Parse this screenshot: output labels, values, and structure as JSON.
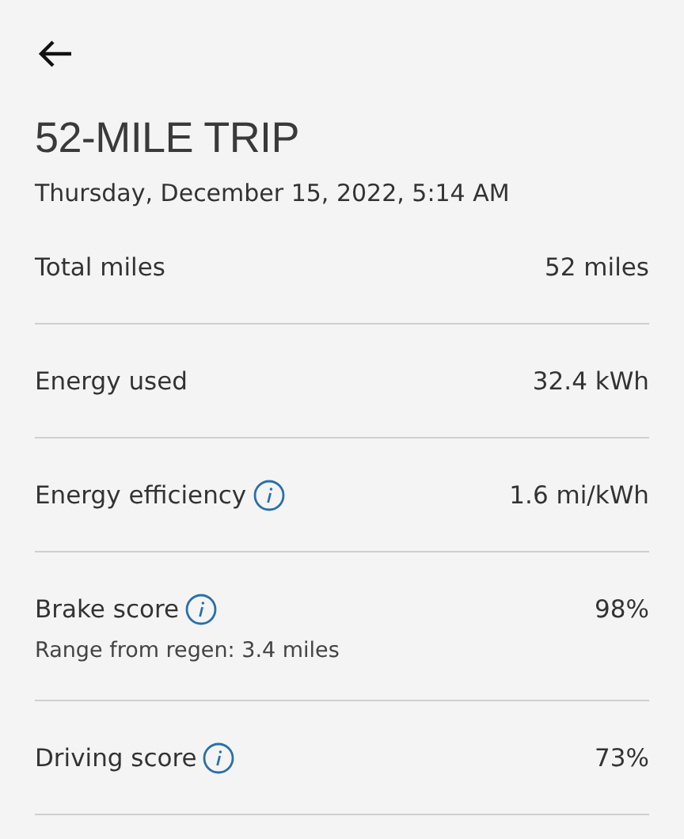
{
  "title": "52-MILE TRIP",
  "date": "Thursday, December 15, 2022, 5:14 AM",
  "rows": [
    {
      "label": "Total miles",
      "value": "52 miles",
      "info": false
    },
    {
      "label": "Energy used",
      "value": "32.4 kWh",
      "info": false
    },
    {
      "label": "Energy efficiency",
      "value": "1.6 mi/kWh",
      "info": true
    },
    {
      "label": "Brake score",
      "value": "98%",
      "info": true,
      "note": "Range from regen: 3.4 miles"
    },
    {
      "label": "Driving score",
      "value": "73%",
      "info": true
    }
  ]
}
